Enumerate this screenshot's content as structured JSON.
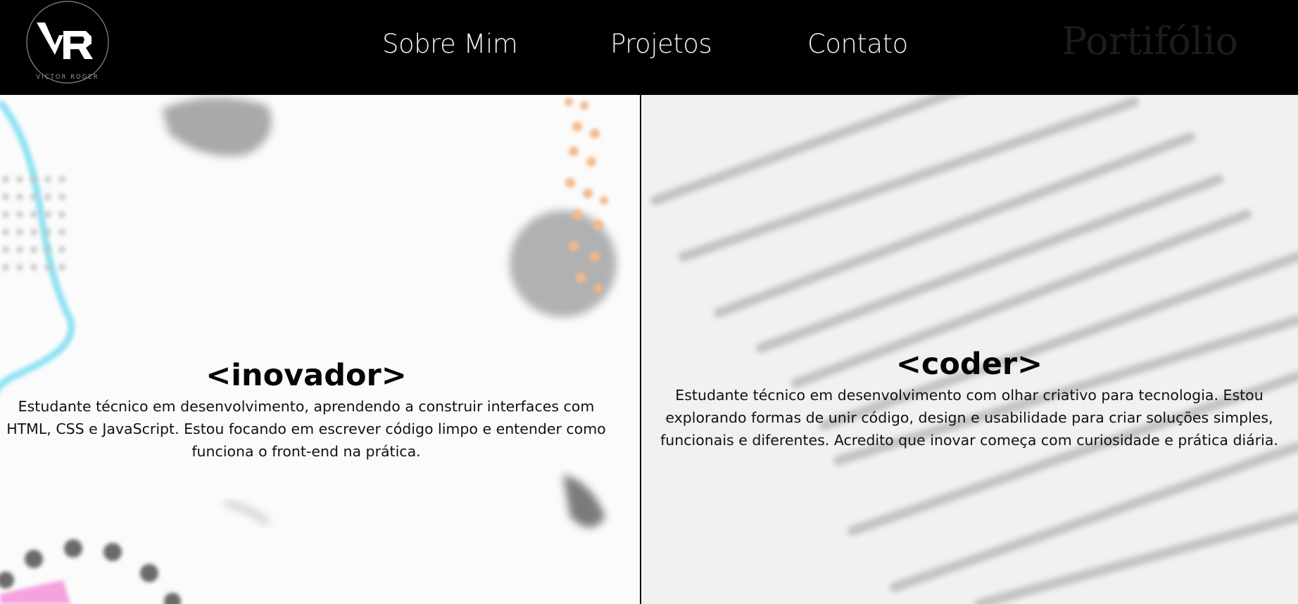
{
  "header": {
    "logo": {
      "initials": "VR",
      "caption": "VICTOR ROGER"
    },
    "nav": [
      {
        "label": "Sobre Mim"
      },
      {
        "label": "Projetos"
      },
      {
        "label": "Contato"
      }
    ],
    "brand_title": "Portifólio"
  },
  "panels": {
    "left": {
      "heading": "<inovador>",
      "text": "Estudante técnico em desenvolvimento, aprendendo a construir interfaces com HTML, CSS e JavaScript. Estou focando em escrever código limpo e entender como funciona o front-end na prática."
    },
    "right": {
      "heading": "<coder>",
      "text": "Estudante técnico em desenvolvimento com olhar criativo para tecnologia. Estou explorando formas de unir código, design e usabilidade para criar soluções simples, funcionais e diferentes. Acredito que inovar começa com curiosidade e prática diária."
    }
  },
  "colors": {
    "header_bg": "#000000",
    "nav_text": "#f2f2f2",
    "brand_title": "#1c1c1c",
    "divider": "#0a0a0a"
  },
  "icons": {
    "logo": "vr-monogram-logo"
  }
}
